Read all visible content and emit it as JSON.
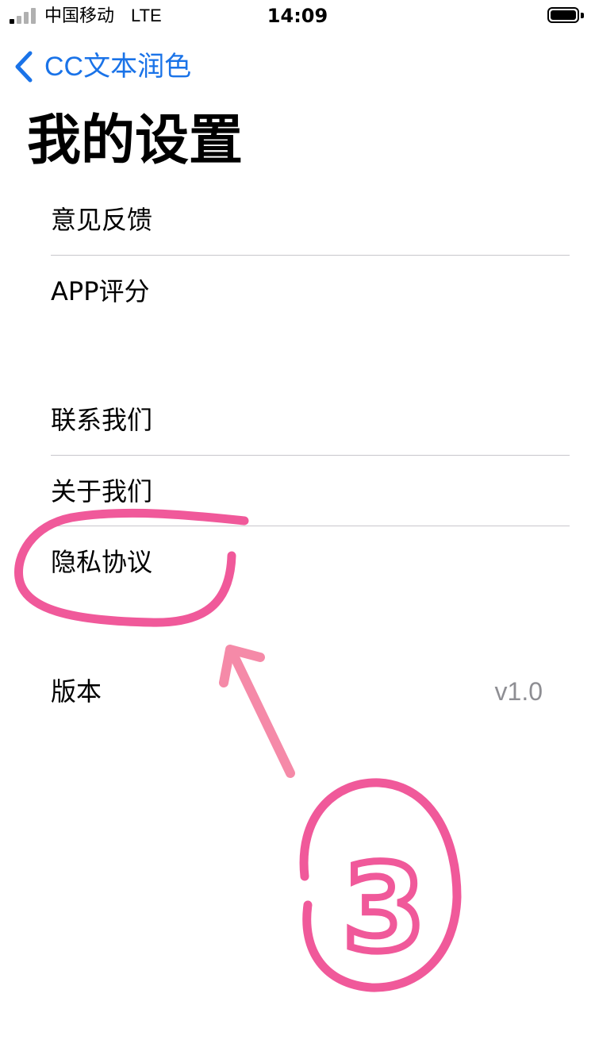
{
  "status_bar": {
    "carrier": "中国移动",
    "network": "LTE",
    "time": "14:09"
  },
  "nav": {
    "back_label": "CC文本润色",
    "back_icon": "chevron-left-icon",
    "accent_color": "#1a73e8"
  },
  "page": {
    "title": "我的设置"
  },
  "settings": {
    "feedback": "意见反馈",
    "rate_app": "APP评分",
    "contact_us": "联系我们",
    "about_us": "关于我们",
    "privacy_policy": "隐私协议",
    "version_label": "版本",
    "version_value": "v1.0"
  },
  "annotation": {
    "step_number": "3",
    "color": "#f0599a"
  }
}
